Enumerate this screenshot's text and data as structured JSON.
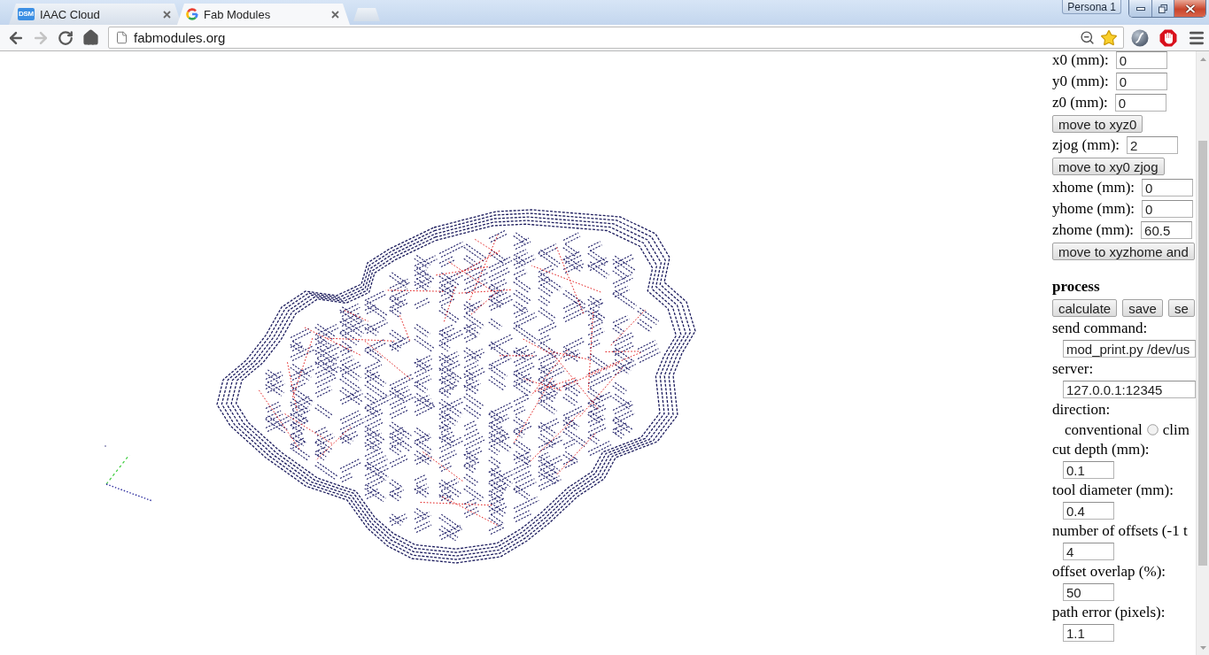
{
  "browser": {
    "tabs": [
      {
        "title": "IAAC Cloud",
        "favicon": {
          "kind": "badge",
          "text": "DSM"
        },
        "selected": false
      },
      {
        "title": "Fab Modules",
        "favicon": {
          "kind": "g_logo"
        },
        "selected": true
      }
    ],
    "profile_button": "Persona 1",
    "nav_buttons": [
      {
        "kind": "back",
        "disabled": false
      },
      {
        "kind": "forward",
        "disabled": true
      },
      {
        "kind": "reload",
        "disabled": false
      },
      {
        "kind": "home",
        "disabled": false
      }
    ],
    "address_bar": {
      "url": "fabmodules.org",
      "bookmarked": true
    }
  },
  "panel": {
    "rows": [
      {
        "kind": "field",
        "label": "x0 (mm):",
        "value": "0"
      },
      {
        "kind": "field",
        "label": "y0 (mm):",
        "value": "0"
      },
      {
        "kind": "field",
        "label": "z0 (mm):",
        "value": "0"
      },
      {
        "kind": "buttons",
        "buttons": [
          "move to xyz0"
        ]
      },
      {
        "kind": "field",
        "label": "zjog (mm):",
        "value": "2"
      },
      {
        "kind": "buttons",
        "buttons": [
          "move to xy0 zjog"
        ]
      },
      {
        "kind": "field",
        "label": "xhome (mm):",
        "value": "0"
      },
      {
        "kind": "field",
        "label": "yhome (mm):",
        "value": "0"
      },
      {
        "kind": "field",
        "label": "zhome (mm):",
        "value": "60.5"
      },
      {
        "kind": "buttons",
        "buttons": [
          "move to xyzhome and"
        ]
      },
      {
        "kind": "heading",
        "text": "process"
      },
      {
        "kind": "buttons",
        "buttons": [
          "calculate",
          "save",
          "se"
        ]
      },
      {
        "kind": "label",
        "text": "send command:"
      },
      {
        "kind": "wide_input",
        "value": "mod_print.py /dev/us"
      },
      {
        "kind": "label",
        "text": "server:"
      },
      {
        "kind": "wide_input",
        "value": "127.0.0.1:12345"
      },
      {
        "kind": "label",
        "text": "direction:"
      },
      {
        "kind": "radio",
        "options": [
          {
            "label": "conventional",
            "selected": false
          }
        ],
        "trailing": "clim"
      },
      {
        "kind": "label",
        "text": "cut depth (mm):"
      },
      {
        "kind": "input",
        "value": "0.1"
      },
      {
        "kind": "label",
        "text": "tool diameter (mm):"
      },
      {
        "kind": "input",
        "value": "0.4"
      },
      {
        "kind": "label",
        "text": "number of offsets (-1 t"
      },
      {
        "kind": "input",
        "value": "4"
      },
      {
        "kind": "label",
        "text": "offset overlap (%):"
      },
      {
        "kind": "input",
        "value": "50"
      },
      {
        "kind": "label",
        "text": "path error (pixels):"
      },
      {
        "kind": "input",
        "value": "1.1"
      }
    ]
  }
}
